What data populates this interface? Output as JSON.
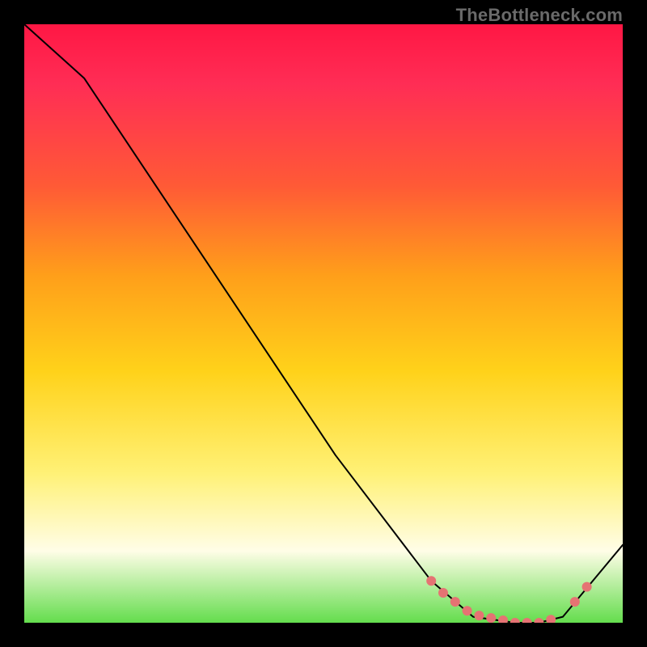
{
  "watermark": "TheBottleneck.com",
  "colors": {
    "curve": "#000000",
    "dot": "#e57373"
  },
  "chart_data": {
    "type": "line",
    "title": "",
    "xlabel": "",
    "ylabel": "",
    "xlim": [
      0,
      100
    ],
    "ylim": [
      0,
      100
    ],
    "annotations": [
      "TheBottleneck.com"
    ],
    "curve_xy": [
      [
        0,
        100
      ],
      [
        10,
        91
      ],
      [
        52,
        28
      ],
      [
        68,
        7
      ],
      [
        75,
        1
      ],
      [
        82,
        0
      ],
      [
        86,
        0
      ],
      [
        90,
        1
      ],
      [
        100,
        13
      ]
    ],
    "markers_xy": [
      [
        68,
        7
      ],
      [
        70,
        5
      ],
      [
        72,
        3.5
      ],
      [
        74,
        2
      ],
      [
        76,
        1.2
      ],
      [
        78,
        0.8
      ],
      [
        80,
        0.4
      ],
      [
        82,
        0
      ],
      [
        84,
        0
      ],
      [
        86,
        0
      ],
      [
        88,
        0.5
      ],
      [
        92,
        3.5
      ],
      [
        94,
        6
      ]
    ]
  }
}
